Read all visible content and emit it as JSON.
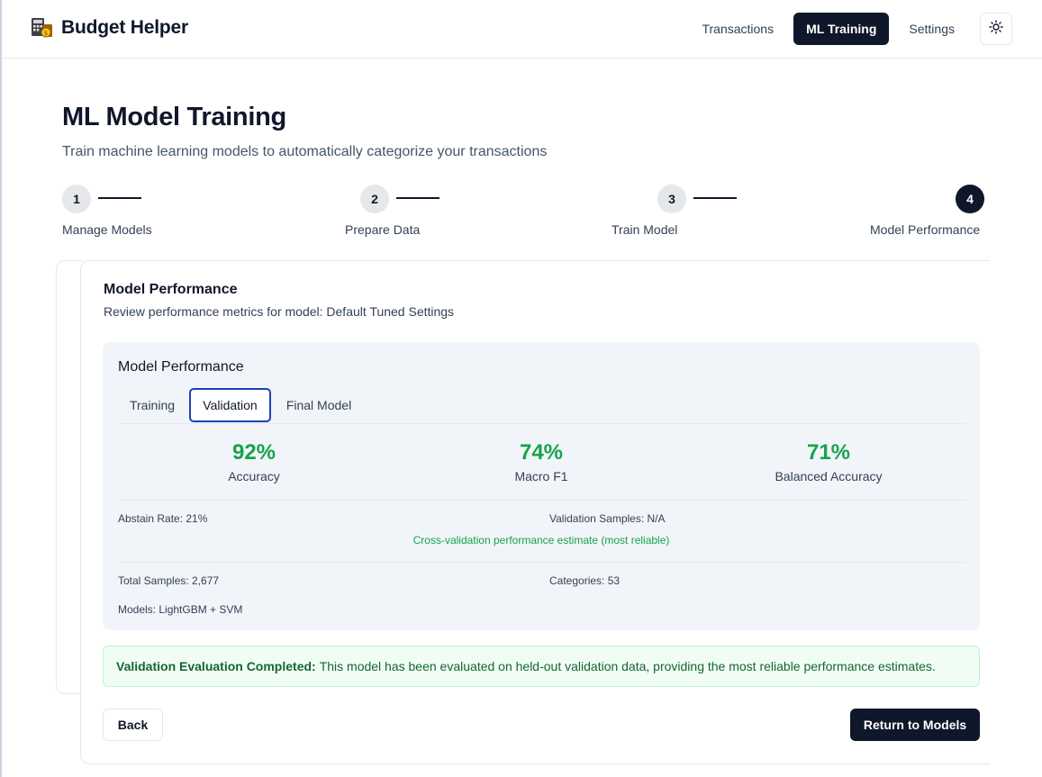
{
  "app": {
    "title": "Budget Helper"
  },
  "nav": {
    "items": [
      {
        "label": "Transactions",
        "active": false
      },
      {
        "label": "ML Training",
        "active": true
      },
      {
        "label": "Settings",
        "active": false
      }
    ],
    "theme_icon": "sun-icon"
  },
  "page": {
    "title": "ML Model Training",
    "subtitle": "Train machine learning models to automatically categorize your transactions"
  },
  "steps": [
    {
      "number": "1",
      "label": "Manage Models",
      "active": false
    },
    {
      "number": "2",
      "label": "Prepare Data",
      "active": false
    },
    {
      "number": "3",
      "label": "Train Model",
      "active": false
    },
    {
      "number": "4",
      "label": "Model Performance",
      "active": true
    }
  ],
  "card": {
    "title": "Model Performance",
    "subtitle": "Review performance metrics for model: Default Tuned Settings"
  },
  "performance": {
    "title": "Model Performance",
    "tabs": [
      {
        "label": "Training",
        "active": false
      },
      {
        "label": "Validation",
        "active": true
      },
      {
        "label": "Final Model",
        "active": false
      }
    ],
    "metrics": [
      {
        "value": "92%",
        "label": "Accuracy"
      },
      {
        "value": "74%",
        "label": "Macro F1"
      },
      {
        "value": "71%",
        "label": "Balanced Accuracy"
      }
    ],
    "abstain_rate": "Abstain Rate: 21%",
    "validation_samples": "Validation Samples: N/A",
    "cv_note": "Cross-validation performance estimate (most reliable)",
    "total_samples": "Total Samples: 2,677",
    "categories": "Categories: 53",
    "models": "Models: LightGBM + SVM"
  },
  "alert": {
    "title": "Validation Evaluation Completed:",
    "message": "This model has been evaluated on held-out validation data, providing the most reliable performance estimates."
  },
  "buttons": {
    "back": "Back",
    "return": "Return to Models"
  },
  "colors": {
    "primary": "#0f172a",
    "success": "#16a34a",
    "panel": "#f1f5f9",
    "tab_focus": "#1e40af"
  }
}
